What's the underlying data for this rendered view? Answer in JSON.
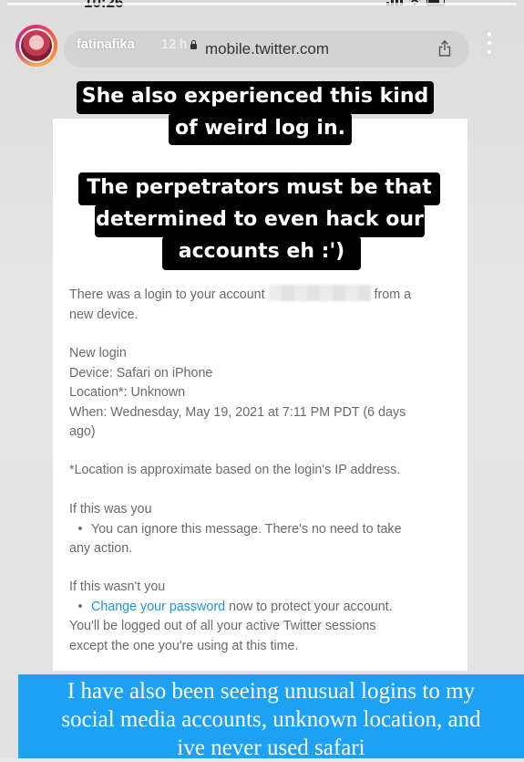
{
  "status": {
    "time": "10:26"
  },
  "story": {
    "username": "fatinafika",
    "time_ago": "12 h",
    "avatar_icon": "profile-avatar"
  },
  "browser": {
    "url": "mobile.twitter.com"
  },
  "captions": {
    "line1a": "She also experienced this kind",
    "line1b": "of weird log in.",
    "line2a": "The perpetrators must be that",
    "line2b": "determined to even hack our",
    "line2c": "accounts eh :')"
  },
  "email": {
    "intro_before": "There was a login to your account",
    "intro_after": "from a",
    "intro_line2": "new device.",
    "new_login": "New login",
    "device": "Device: Safari on iPhone",
    "location": "Location*: Unknown",
    "when_line1": "When: Wednesday, May 19, 2021 at 7:11 PM PDT (6 days",
    "when_line2": "ago)",
    "note": "*Location is approximate based on the login's IP address.",
    "if_you": "If this was you",
    "if_you_bullet_line1": "You can ignore this message. There's no need to take",
    "if_you_bullet_line2": "any action.",
    "if_not": "If this wasn't you",
    "change_password_link": "Change your password",
    "change_password_rest": "now to protect your account.",
    "logout_line1": "You'll be logged out of all your active Twitter sessions",
    "logout_line2": "except the one you're using at this time."
  },
  "bottom_caption": {
    "line1": "I have also been seeing unusual logins to my",
    "line2": "social media accounts, unknown location, and",
    "line3": "ive never used safari"
  },
  "colors": {
    "link": "#1b95e0",
    "caption_blue": "#1da1f2"
  }
}
